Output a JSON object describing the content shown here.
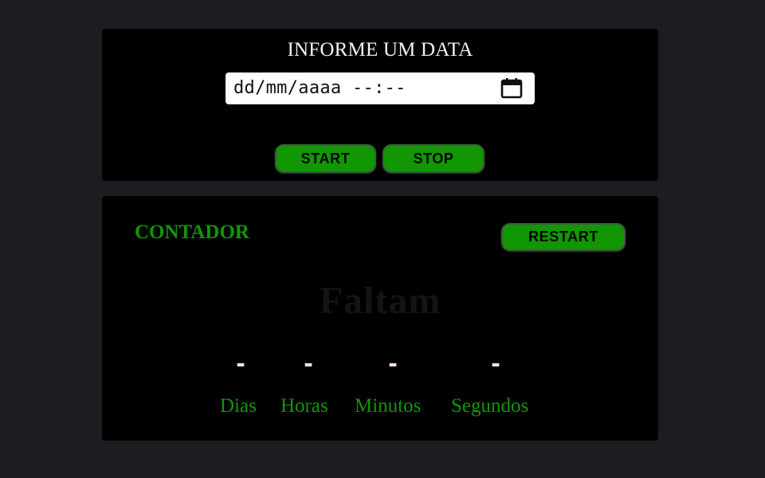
{
  "form": {
    "title": "INFORME UM DATA",
    "date_placeholder": "dd/mm/aaaa --:--",
    "start_label": "START",
    "stop_label": "STOP"
  },
  "counter": {
    "title": "CONTADOR",
    "restart_label": "RESTART",
    "heading": "Faltam",
    "units": [
      {
        "value": "-",
        "label": "Dias"
      },
      {
        "value": "-",
        "label": "Horas"
      },
      {
        "value": "-",
        "label": "Minutos"
      },
      {
        "value": "-",
        "label": "Segundos"
      }
    ]
  },
  "colors": {
    "page_background": "#1c1d21",
    "panel_background": "#000000",
    "accent_green": "#109702",
    "value_pink": "#ffe0e4"
  },
  "icons": {
    "date_picker": "calendar-icon"
  }
}
